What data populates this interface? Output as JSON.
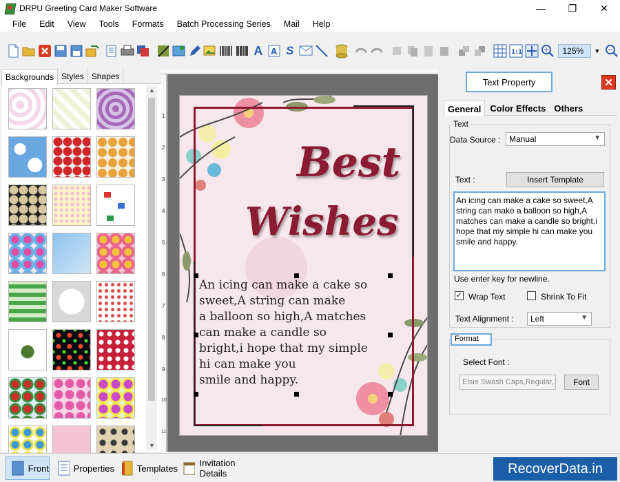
{
  "window": {
    "title": "DRPU Greeting Card Maker Software",
    "controls": [
      "—",
      "❐",
      "✕"
    ]
  },
  "menu": [
    "File",
    "Edit",
    "View",
    "Tools",
    "Formats",
    "Batch Processing Series",
    "Mail",
    "Help"
  ],
  "toolbar": {
    "zoom": "125%"
  },
  "left_panel": {
    "tabs": [
      "Backgrounds",
      "Styles",
      "Shapes"
    ],
    "active_tab": "Backgrounds"
  },
  "ruler": {
    "left_marks": [
      "1",
      "2",
      "3",
      "4",
      "5",
      "6",
      "7",
      "8",
      "9",
      "10",
      "11"
    ]
  },
  "card": {
    "heading1": "Best",
    "heading2": "Wishes",
    "message_lines": [
      "An icing can make a cake so",
      "sweet,A string can make",
      "a balloon so high,A matches",
      "can make a candle so",
      "bright,i hope that my simple",
      "hi can make you",
      "smile and happy."
    ]
  },
  "right_panel": {
    "title": "Text Property",
    "tabs": [
      "General",
      "Color Effects",
      "Others"
    ],
    "text_group_label": "Text",
    "data_source_label": "Data Source :",
    "data_source_value": "Manual",
    "text_label": "Text :",
    "insert_template_label": "Insert Template",
    "text_value": "An icing can make a cake so sweet,A string can make a balloon so high,A matches can make a candle so bright,i hope that my simple hi can make you smile and happy.",
    "enter_hint": "Use enter key for newline.",
    "wrap_text_label": "Wrap Text",
    "wrap_text_checked": true,
    "shrink_label": "Shrink To Fit",
    "shrink_checked": false,
    "alignment_label": "Text Alignment :",
    "alignment_value": "Left",
    "format_label": "Format",
    "select_font_label": "Select Font :",
    "font_value": "Elsie Swash Caps,Regular,1...",
    "font_button_label": "Font"
  },
  "bottom_tabs": [
    "Front",
    "Properties",
    "Templates",
    "Invitation Details"
  ],
  "watermark": "RecoverData.in"
}
